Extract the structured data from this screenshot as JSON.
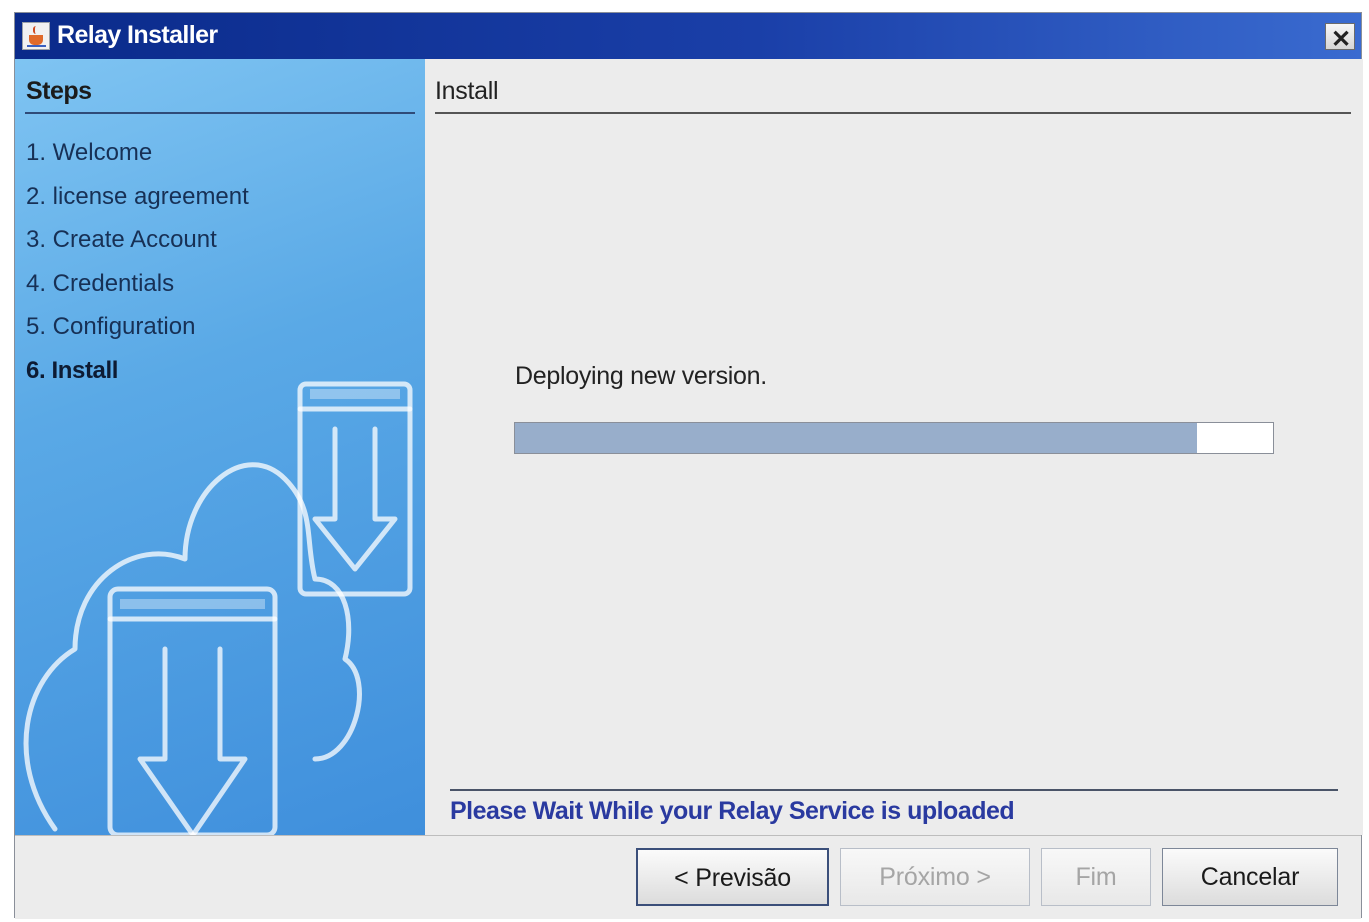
{
  "window": {
    "title": "Relay Installer",
    "icon": "java-cup-icon",
    "close_icon": "close-icon"
  },
  "steps_panel": {
    "heading": "Steps",
    "items": [
      {
        "label": "1. Welcome"
      },
      {
        "label": "2. license agreement"
      },
      {
        "label": "3. Create Account"
      },
      {
        "label": "4. Credentials"
      },
      {
        "label": "5. Configuration"
      },
      {
        "label": "6. Install",
        "active": true
      }
    ]
  },
  "content": {
    "heading": "Install",
    "message": "Deploying new version.",
    "progress": 0.9,
    "status": "Please Wait While your Relay Service is uploaded"
  },
  "buttons": {
    "previous": "< Previsão",
    "next": "Próximo >",
    "finish": "Fim",
    "cancel": "Cancelar"
  },
  "colors": {
    "titlebar": "#0a2a8a",
    "steps_panel": "#5aa9e6",
    "status_text": "#2a3aa0",
    "progress_fill": "#98aecb"
  }
}
